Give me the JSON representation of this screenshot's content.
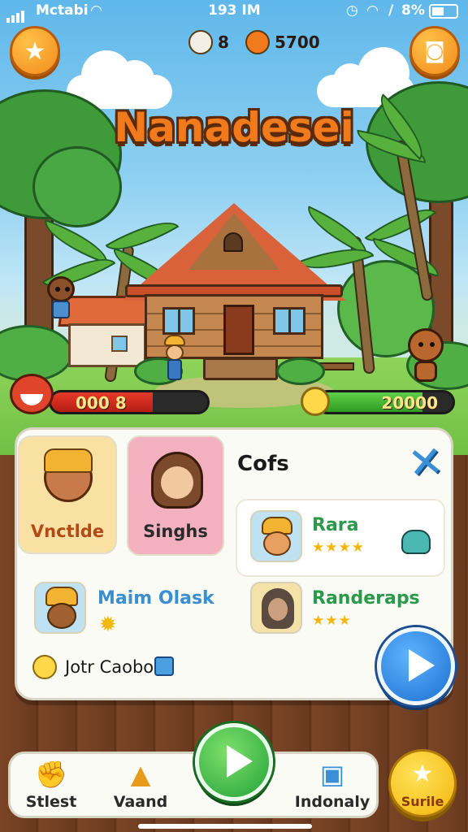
{
  "status_bar": {
    "carrier": "Mctabi",
    "time": "193 IM",
    "battery": "8%"
  },
  "hud": {
    "left_button_icon": "star-icon",
    "right_button_icon": "camera-icon",
    "pet_count": "8",
    "fruit_count": "5700"
  },
  "game_title": "Nanadesei",
  "meters": {
    "health_text": "000 8",
    "health_fill": 0.65,
    "coins_text": "20000",
    "coins_fill": 0.78
  },
  "panel": {
    "heading": "Cofs",
    "cards": [
      {
        "label": "Vnctlde",
        "bg": "#f8e1a3",
        "color": "#b24a18"
      },
      {
        "label": "Singhs",
        "bg": "#f3b1bf",
        "color": "#2a2a2a"
      }
    ],
    "friends": [
      {
        "name": "Rara",
        "stars": "★★★★",
        "color": "#2a9a4a"
      },
      {
        "name": "Maim Olask",
        "stars": "",
        "color": "#3a8fd0"
      },
      {
        "name": "Randeraps",
        "stars": "★★★",
        "color": "#2a9a4a"
      }
    ],
    "footer_text": "Jotr Caobo"
  },
  "nav": {
    "items": [
      {
        "label": "Stlest",
        "icon": "fist-icon"
      },
      {
        "label": "Vaand",
        "icon": "tent-icon"
      },
      {
        "label": "Indonaly",
        "icon": "gift-box-icon"
      }
    ],
    "special_label": "Surile"
  }
}
